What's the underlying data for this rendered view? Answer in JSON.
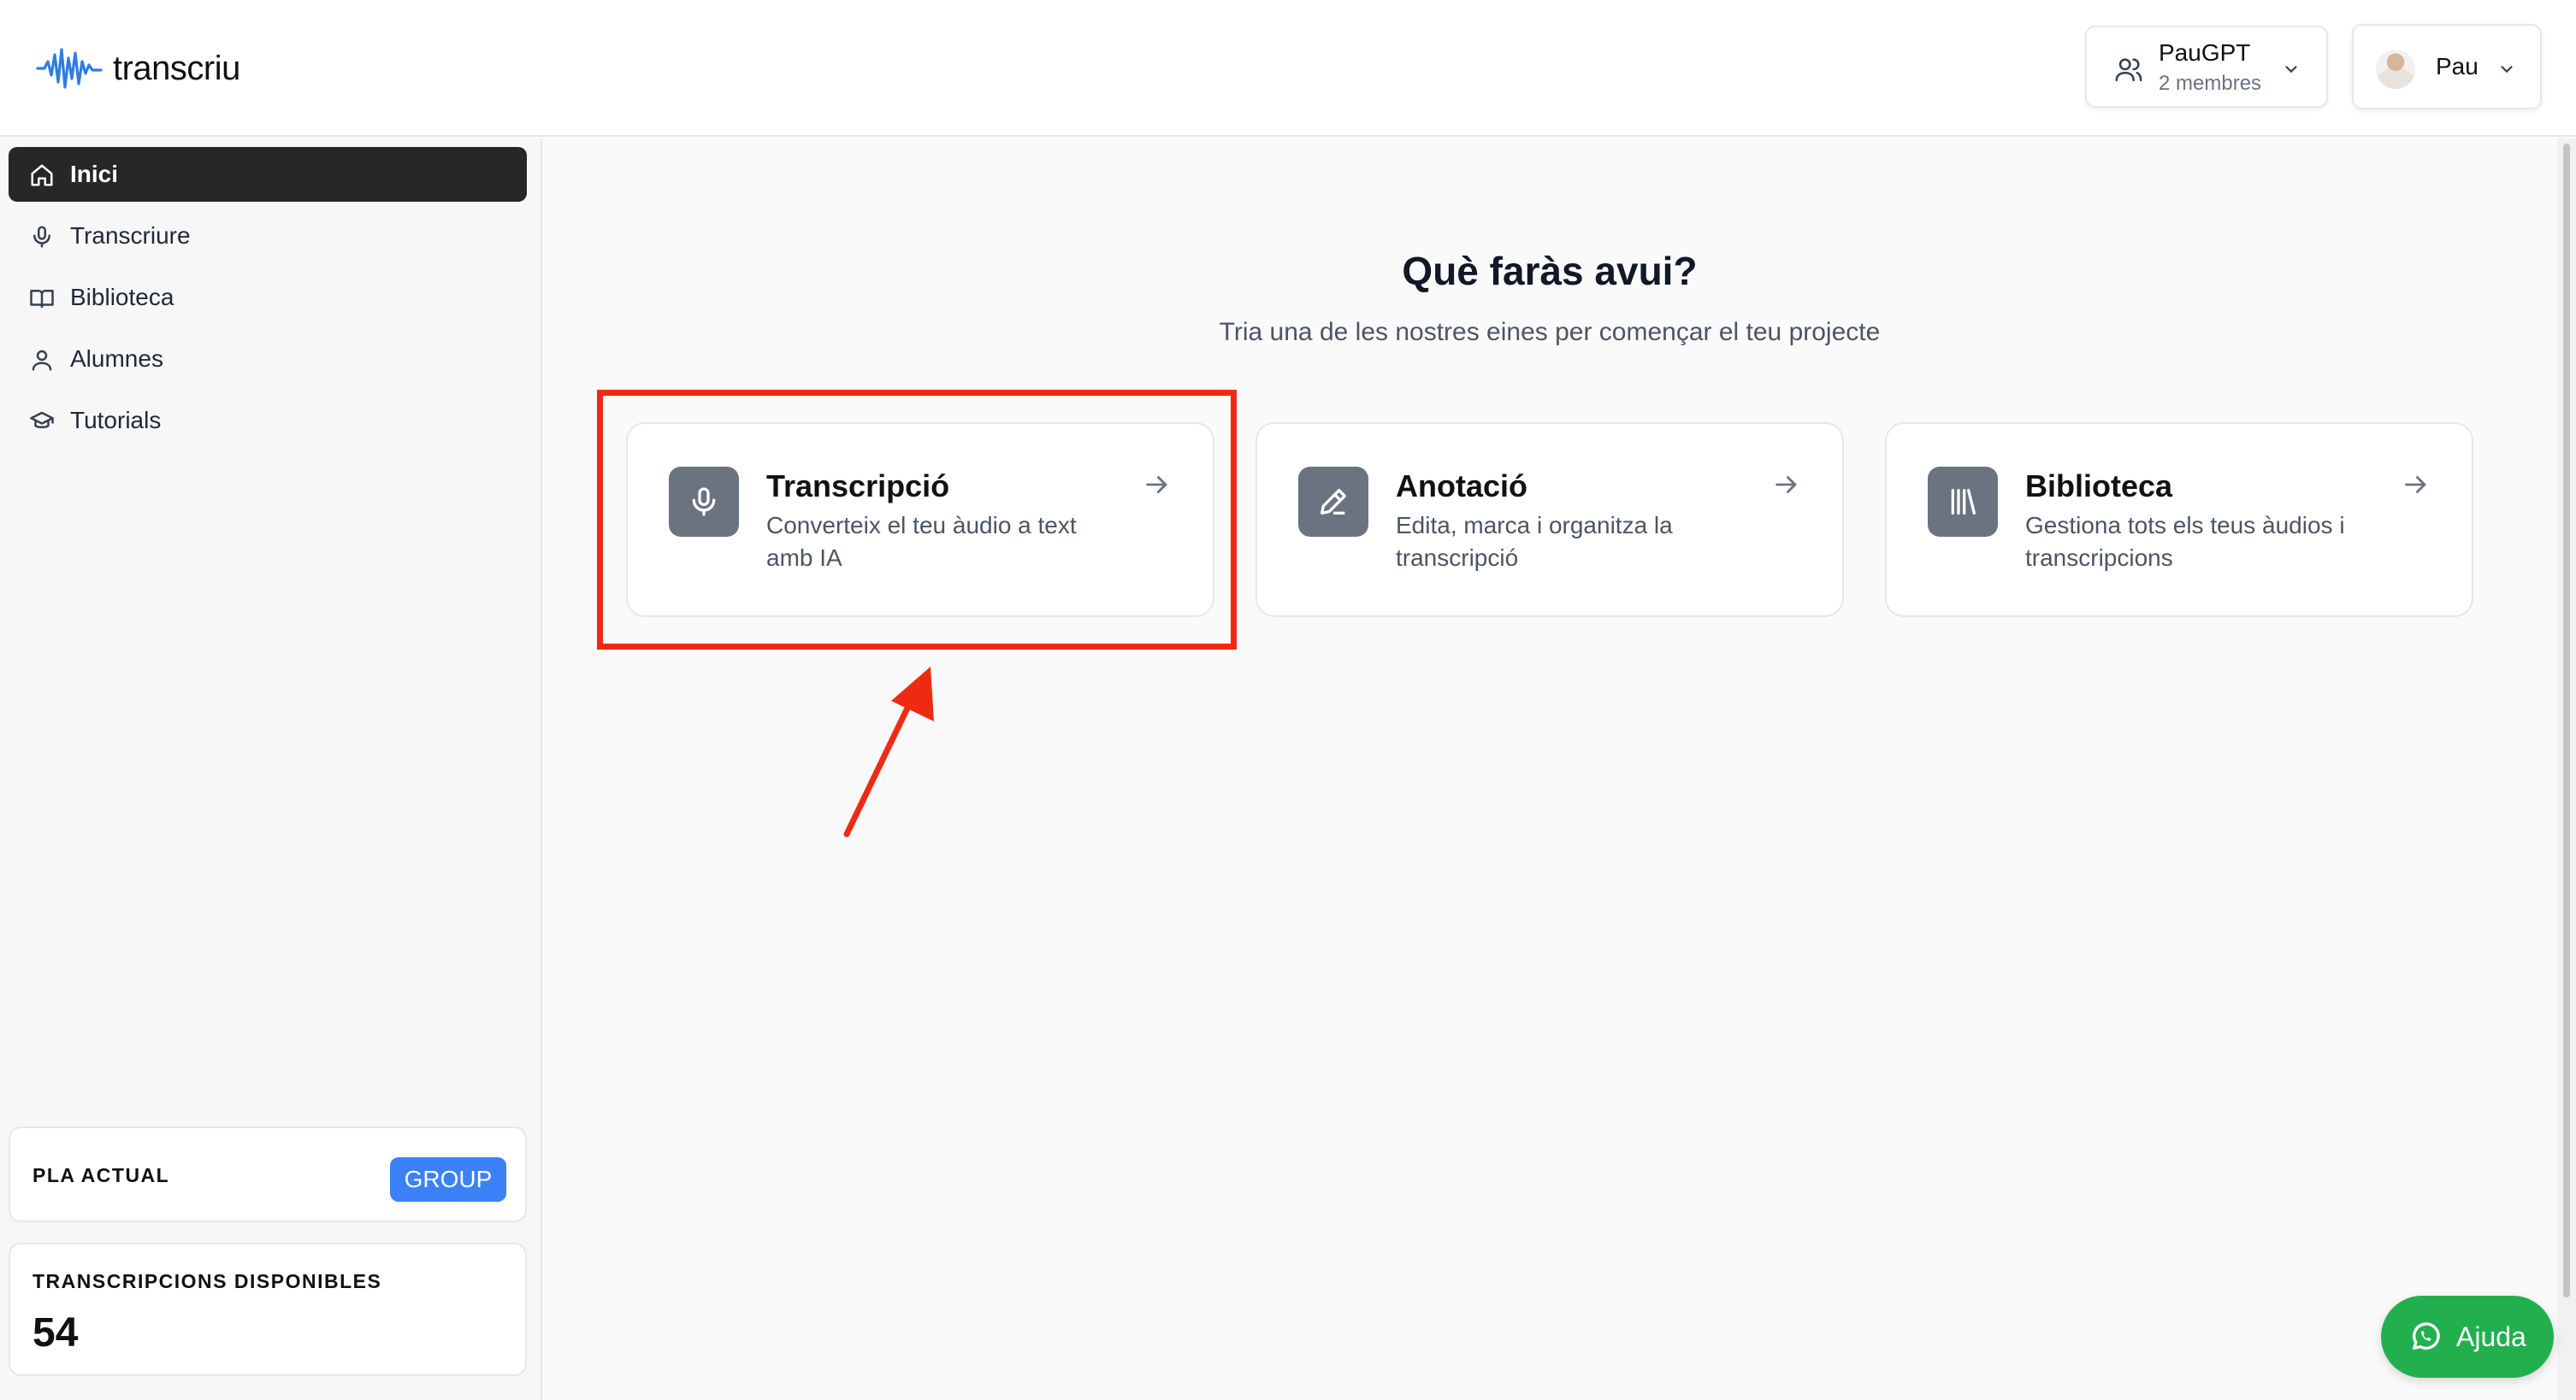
{
  "app": {
    "brand": "transcriu"
  },
  "header": {
    "workspace": {
      "name": "PauGPT",
      "members": "2 membres"
    },
    "user": {
      "name": "Pau"
    }
  },
  "sidebar": {
    "items": [
      {
        "label": "Inici",
        "icon": "home-icon",
        "active": true
      },
      {
        "label": "Transcriure",
        "icon": "microphone-icon",
        "active": false
      },
      {
        "label": "Biblioteca",
        "icon": "book-open-icon",
        "active": false
      },
      {
        "label": "Alumnes",
        "icon": "user-icon",
        "active": false
      },
      {
        "label": "Tutorials",
        "icon": "graduation-cap-icon",
        "active": false
      }
    ],
    "plan": {
      "label": "PLA ACTUAL",
      "value": "GROUP"
    },
    "credits": {
      "label": "TRANSCRIPCIONS DISPONIBLES",
      "value": "54"
    }
  },
  "main": {
    "title": "Què faràs avui?",
    "subtitle": "Tria una de les nostres eines per començar el teu projecte",
    "cards": [
      {
        "title": "Transcripció",
        "description": "Converteix el teu àudio a text amb IA",
        "icon": "microphone-icon"
      },
      {
        "title": "Anotació",
        "description": "Edita, marca i organitza la transcripció",
        "icon": "pencil-icon"
      },
      {
        "title": "Biblioteca",
        "description": "Gestiona tots els teus àudios i transcripcions",
        "icon": "library-icon"
      }
    ]
  },
  "help": {
    "label": "Ajuda",
    "icon": "whatsapp-icon"
  },
  "colors": {
    "accent": "#3b82f6",
    "sidebar_active": "#27272a",
    "highlight": "#ef2a12",
    "help": "#22b04f",
    "icon_tile": "#6b7280"
  }
}
